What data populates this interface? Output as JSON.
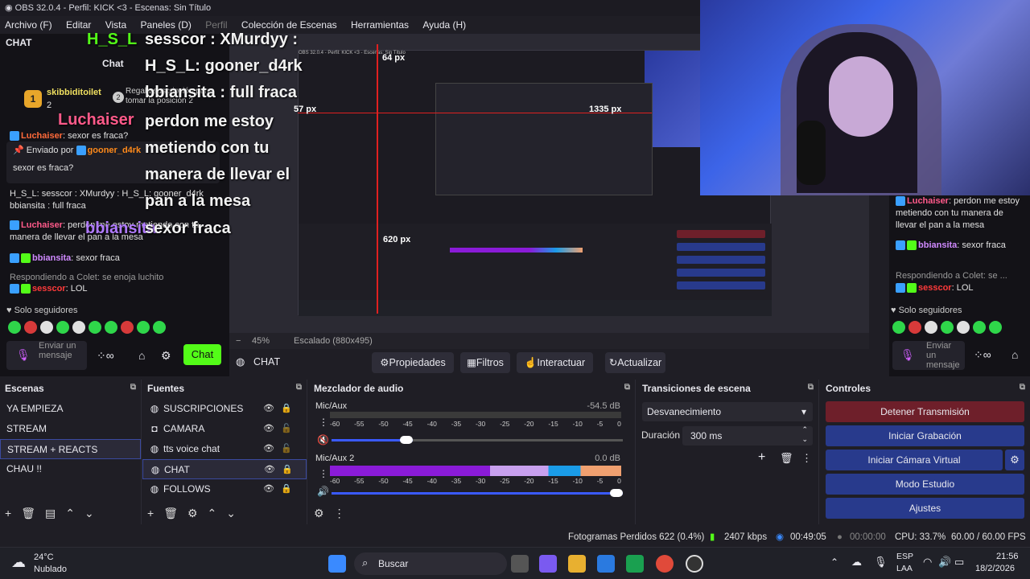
{
  "window": {
    "title": "OBS 32.0.4 - Perfil: KICK <3 - Escenas: Sin Título"
  },
  "menu": [
    {
      "label": "Archivo (F)",
      "disabled": false
    },
    {
      "label": "Editar",
      "disabled": false
    },
    {
      "label": "Vista",
      "disabled": false
    },
    {
      "label": "Paneles (D)",
      "disabled": false
    },
    {
      "label": "Perfil",
      "disabled": true
    },
    {
      "label": "Colección de Escenas",
      "disabled": false
    },
    {
      "label": "Herramientas",
      "disabled": false
    },
    {
      "label": "Ayuda (H)",
      "disabled": false
    }
  ],
  "left_chat": {
    "header": "CHAT",
    "tab": "Chat",
    "gift_user": "skibbiditoilet",
    "gift_count": "2",
    "gift_rank": "2",
    "gift_note": "Regala suscripción para tomar la posición 2",
    "pinned_by": "Enviado por",
    "pinned_user": "gooner_d4rk",
    "pinned_text": "sexor es fraca?",
    "lines": [
      {
        "user": "Luchaiser",
        "text": "sexor es fraca?"
      },
      {
        "user": "",
        "text": "H_S_L: sesscor : XMurdyy : H_S_L: gooner_d4rk"
      },
      {
        "user": "",
        "text": "bbiansita : full fraca"
      },
      {
        "user": "Luchaiser",
        "text": "perdon me estoy metiendo con tu manera de llevar el pan a la mesa"
      },
      {
        "user": "bbiansita",
        "text": "sexor fraca"
      },
      {
        "user": "",
        "text": "Respondiendo a Colet: se enoja luchito"
      },
      {
        "user": "sesscor",
        "text": "LOL"
      }
    ],
    "followers_only": "Solo seguidores",
    "send_placeholder": "Enviar un mensaje",
    "chat_button": "Chat"
  },
  "overlay": {
    "big_lines": [
      "sesscor : XMurdyy :",
      "H_S_L: gooner_d4rk",
      "bbiansita : full fraca",
      "perdon me estoy",
      "metiendo con tu",
      "manera de llevar el",
      "pan a la mesa",
      "sexor fraca"
    ],
    "big_user_1": "H_S_L",
    "big_user_2": "Luchaiser",
    "big_user_3": "bbiansita",
    "measure_top": "64 px",
    "measure_left": "57 px",
    "measure_right": "1335 px",
    "measure_bottom": "620 px"
  },
  "right_chat": {
    "lines": [
      {
        "user": "Luchaiser",
        "text": "perdon me estoy metiendo con tu manera de llevar el pan a la mesa"
      },
      {
        "user": "bbiansita",
        "text": "sexor fraca"
      },
      {
        "user": "",
        "text": "Respondiendo a Colet: se ..."
      },
      {
        "user": "sesscor",
        "text": "LOL"
      }
    ],
    "followers_only": "Solo seguidores",
    "send_placeholder": "Enviar un mensaje"
  },
  "zoom": {
    "level": "45%",
    "scaling": "Escalado (880x495)"
  },
  "toolbar": {
    "source_name": "CHAT",
    "properties": "Propiedades",
    "filters": "Filtros",
    "interact": "Interactuar",
    "refresh": "Actualizar"
  },
  "scenes": {
    "title": "Escenas",
    "items": [
      "YA EMPIEZA",
      "STREAM",
      "STREAM + REACTS",
      "CHAU !!"
    ],
    "selected": 2
  },
  "sources": {
    "title": "Fuentes",
    "items": [
      {
        "label": "SUSCRIPCIONES",
        "icon": "browser-icon",
        "locked": true
      },
      {
        "label": "CAMARA",
        "icon": "camera-icon",
        "locked": false
      },
      {
        "label": "tts voice chat",
        "icon": "browser-icon",
        "locked": false
      },
      {
        "label": "CHAT",
        "icon": "browser-icon",
        "locked": true
      },
      {
        "label": "FOLLOWS",
        "icon": "browser-icon",
        "locked": true
      }
    ],
    "selected": 3
  },
  "mixer": {
    "title": "Mezclador de audio",
    "channels": [
      {
        "name": "Mic/Aux",
        "db": "-54.5 dB",
        "muted": true,
        "level": 0.0,
        "volume": 0.28
      },
      {
        "name": "Mic/Aux 2",
        "db": "0.0 dB",
        "muted": false,
        "level": 1.0,
        "volume": 1.0
      }
    ],
    "ticks": [
      "-60",
      "-55",
      "-50",
      "-45",
      "-40",
      "-35",
      "-30",
      "-25",
      "-20",
      "-15",
      "-10",
      "-5",
      "0"
    ]
  },
  "transitions": {
    "title": "Transiciones de escena",
    "selected": "Desvanecimiento",
    "duration_label": "Duración",
    "duration_value": "300 ms"
  },
  "controls": {
    "title": "Controles",
    "buttons": [
      "Detener Transmisión",
      "Iniciar Grabación",
      "Iniciar Cámara Virtual",
      "Modo Estudio",
      "Ajustes"
    ]
  },
  "status": {
    "dropped": "Fotogramas Perdidos 622 (0.4%)",
    "bitrate": "2407 kbps",
    "stream_time": "00:49:05",
    "rec_time": "00:00:00",
    "cpu": "CPU: 33.7%",
    "fps": "60.00 / 60.00 FPS"
  },
  "taskbar": {
    "weather_temp": "24°C",
    "weather_desc": "Nublado",
    "search": "Buscar",
    "lang1": "ESP",
    "lang2": "LAA",
    "time": "21:56",
    "date": "18/2/2026"
  },
  "colors": {
    "accent": "#283a8c",
    "stop": "#6e1f2a",
    "kick_green": "#53fc18",
    "meter_purple": "#8a1bd8",
    "meter_blue": "#1a9ce8",
    "meter_peach": "#f0a070"
  }
}
